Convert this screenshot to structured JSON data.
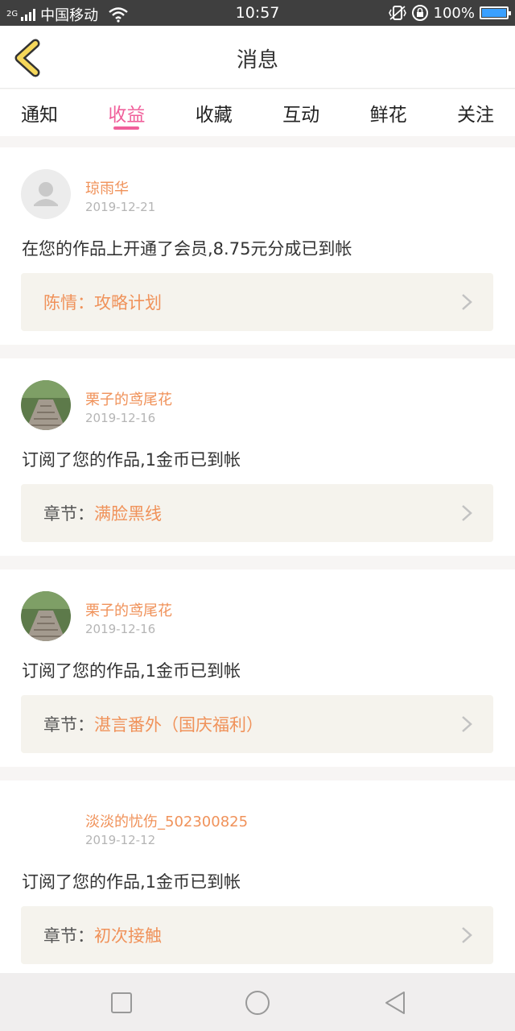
{
  "status_bar": {
    "network": "2G",
    "carrier": "中国移动",
    "time": "10:57",
    "battery": "100%",
    "battery_level": 1.0
  },
  "header": {
    "title": "消息"
  },
  "tabs": [
    {
      "label": "通知"
    },
    {
      "label": "收益",
      "active": true
    },
    {
      "label": "收藏"
    },
    {
      "label": "互动"
    },
    {
      "label": "鲜花"
    },
    {
      "label": "关注"
    }
  ],
  "items": [
    {
      "name": "琼雨华",
      "date": "2019-12-21",
      "message": "在您的作品上开通了会员,8.75元分成已到帐",
      "ref_prefix": "陈情：",
      "ref_value": "攻略计划",
      "avatar": "default-avatar-icon"
    },
    {
      "name": "栗子的鸢尾花",
      "date": "2019-12-16",
      "message": "订阅了您的作品,1金币已到帐",
      "ref_prefix": "章节：",
      "ref_value": "满脸黑线",
      "avatar": "path-photo"
    },
    {
      "name": "栗子的鸢尾花",
      "date": "2019-12-16",
      "message": "订阅了您的作品,1金币已到帐",
      "ref_prefix": "章节：",
      "ref_value": "湛言番外（国庆福利）",
      "avatar": "path-photo"
    },
    {
      "name": "淡淡的忧伤_502300825",
      "date": "2019-12-12",
      "message": "订阅了您的作品,1金币已到帐",
      "ref_prefix": "章节：",
      "ref_value": "初次接触",
      "avatar": "none"
    }
  ],
  "colors": {
    "accent": "#f0609b",
    "orange": "#f0925a",
    "back_arrow": "#f5d75a"
  }
}
